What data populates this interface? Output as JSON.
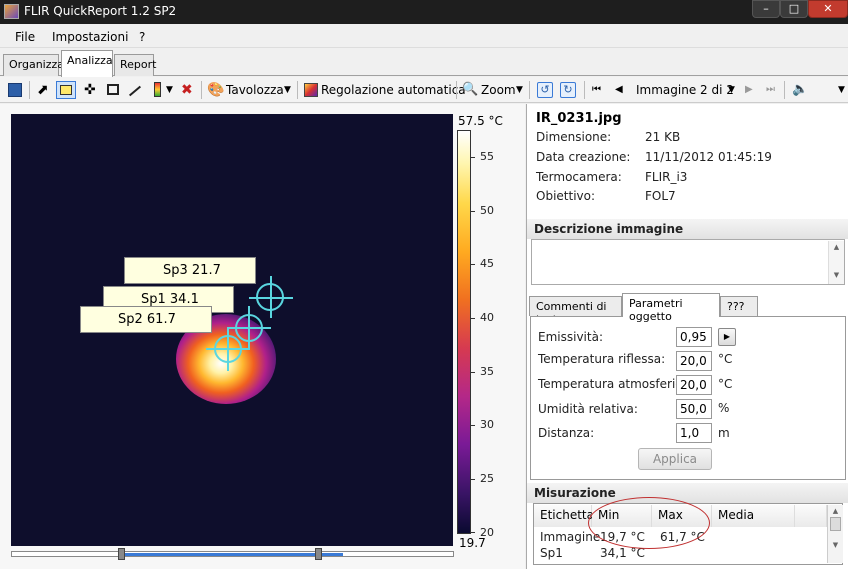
{
  "window": {
    "title": "FLIR QuickReport 1.2 SP2"
  },
  "menu": [
    "File",
    "Impostazioni",
    "?"
  ],
  "tabs": [
    "Organizza",
    "Analizza",
    "Report"
  ],
  "toolbar": {
    "tavolozza": "Tavolozza",
    "regolazione": "Regolazione automatica",
    "zoom": "Zoom",
    "image_nav": "Immagine 2 di 2"
  },
  "image": {
    "spots": [
      {
        "label": "Sp3 21.7"
      },
      {
        "label": "Sp1 34.1"
      },
      {
        "label": "Sp2 61.7"
      }
    ],
    "scale": {
      "max": "57.5 °C",
      "min": "19.7",
      "ticks": [
        "55",
        "50",
        "45",
        "40",
        "35",
        "30",
        "25",
        "20"
      ]
    }
  },
  "info": {
    "filename": "IR_0231.jpg",
    "rows": [
      {
        "key": "Dimensione:",
        "value": "21 KB"
      },
      {
        "key": "Data creazione:",
        "value": "11/11/2012 01:45:19"
      },
      {
        "key": "Termocamera:",
        "value": "FLIR_i3"
      },
      {
        "key": "Obiettivo:",
        "value": "FOL7"
      }
    ]
  },
  "descrizione": {
    "title": "Descrizione immagine",
    "text": ""
  },
  "param_tabs": [
    "Commenti di testo",
    "Parametri oggetto",
    "???"
  ],
  "params": [
    {
      "label": "Emissività:",
      "value": "0,95",
      "unit": ""
    },
    {
      "label": "Temperatura riflessa:",
      "value": "20,0",
      "unit": "°C"
    },
    {
      "label": "Temperatura atmosferica:",
      "value": "20,0",
      "unit": "°C"
    },
    {
      "label": "Umidità relativa:",
      "value": "50,0",
      "unit": "%"
    },
    {
      "label": "Distanza:",
      "value": "1,0",
      "unit": "m"
    }
  ],
  "apply_label": "Applica",
  "measurement": {
    "title": "Misurazione",
    "columns": [
      "Etichetta",
      "Min",
      "Max",
      "Media"
    ],
    "rows": [
      [
        "Immagine",
        "19,7 °C",
        "61,7 °C",
        ""
      ],
      [
        "Sp1",
        "34,1 °C",
        "",
        ""
      ]
    ]
  }
}
